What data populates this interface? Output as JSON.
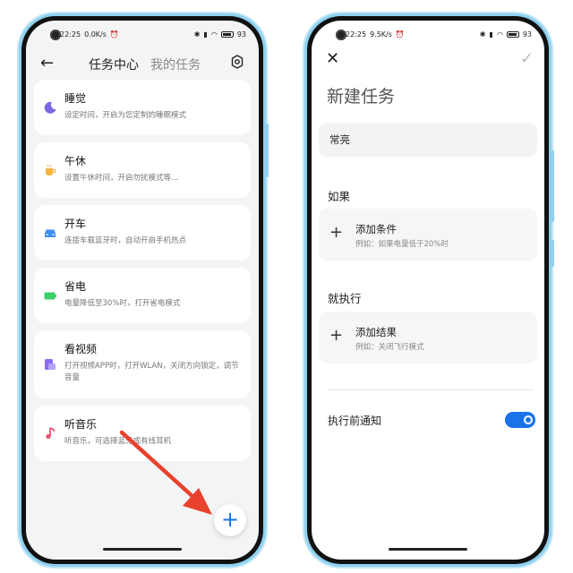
{
  "left": {
    "status": {
      "time": "22:25",
      "speed": "0.0K/s",
      "battery": "93"
    },
    "header": {
      "active_tab": "任务中心",
      "inactive_tab": "我的任务"
    },
    "cards": [
      {
        "title": "睡觉",
        "desc": "设定时间，开启为您定制的睡眠模式",
        "icon": "moon-icon"
      },
      {
        "title": "午休",
        "desc": "设置午休时间，开启勿扰模式等...",
        "icon": "coffee-cup-icon"
      },
      {
        "title": "开车",
        "desc": "连接车载蓝牙时，自动开启手机热点",
        "icon": "car-icon"
      },
      {
        "title": "省电",
        "desc": "电量降低至30%时，打开省电模式",
        "icon": "battery-icon"
      },
      {
        "title": "看视频",
        "desc": "打开视频APP时，打开WLAN，关闭方向锁定，调节音量",
        "icon": "video-app-icon"
      },
      {
        "title": "听音乐",
        "desc": "听音乐，可选择蓝牙或有线耳机",
        "icon": "music-note-icon"
      }
    ],
    "fab_label": "+"
  },
  "right": {
    "status": {
      "time": "22:25",
      "speed": "9.5K/s",
      "battery": "93"
    },
    "title": "新建任务",
    "task_name": "常亮",
    "if_label": "如果",
    "condition": {
      "title": "添加条件",
      "hint": "例如：如果电量低于20%时"
    },
    "then_label": "就执行",
    "result": {
      "title": "添加结果",
      "hint": "例如：关闭飞行模式"
    },
    "notify_label": "执行前通知",
    "notify_on": true
  },
  "colors": {
    "accent": "#1a73e8",
    "arrow": "#e8412c",
    "frame": "#8fd0ef"
  }
}
